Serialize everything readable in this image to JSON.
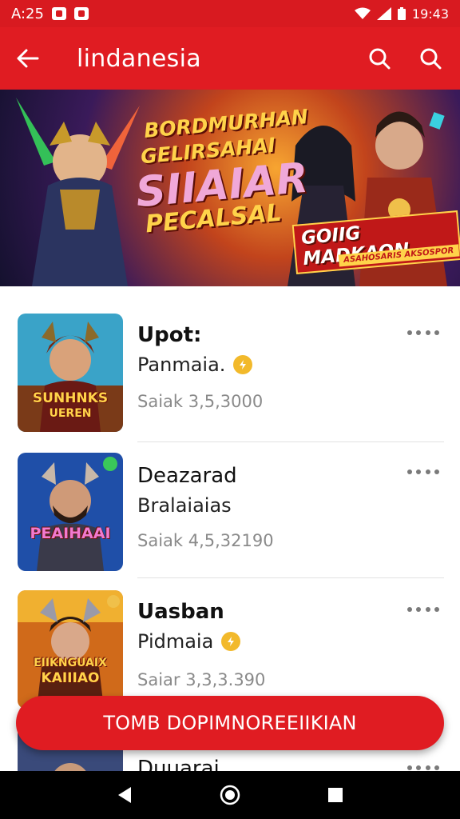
{
  "status_bar": {
    "time": "A:25",
    "battery_text": "19:43"
  },
  "app_bar": {
    "title": "lindanesia",
    "icons": [
      "back-arrow-icon",
      "search-icon",
      "search-icon"
    ]
  },
  "banner": {
    "line1": "BORDMURHAN",
    "line2": "GELIRSAHAI",
    "line3": "SIIAIAR",
    "line4": "PECALSAL",
    "badge": "GOIIG MADKAON",
    "badge_sub": "ASAHOSARIS AKSOSPOR"
  },
  "games": [
    {
      "title": "Upot:",
      "subtitle": "Panmaia.",
      "meta": "Saiak 3,5,3000",
      "thumb_label_1": "SUNHNKS",
      "thumb_label_2": "UEREN",
      "verified": true
    },
    {
      "title": "Deazarad",
      "subtitle": "Bralaiaias",
      "meta": "Saiak 4,5,32190",
      "thumb_label_1": "PEAIHAAI",
      "thumb_label_2": "",
      "verified": false
    },
    {
      "title": "Uasban",
      "subtitle": "Pidmaia",
      "meta": "Saiar 3,3,3.390",
      "thumb_label_1": "EIIKNGUAIX",
      "thumb_label_2": "KAIIIAO",
      "verified": true
    },
    {
      "title": "Duuarai",
      "subtitle": "",
      "meta": "",
      "thumb_label_1": "",
      "thumb_label_2": "",
      "verified": false
    }
  ],
  "cta": {
    "label": "TOMB DOPIMNOREEIIKIAN"
  },
  "colors": {
    "primary": "#e01c22",
    "status": "#d81a20",
    "verified": "#f2b92b",
    "meta": "#8a8a8a"
  }
}
